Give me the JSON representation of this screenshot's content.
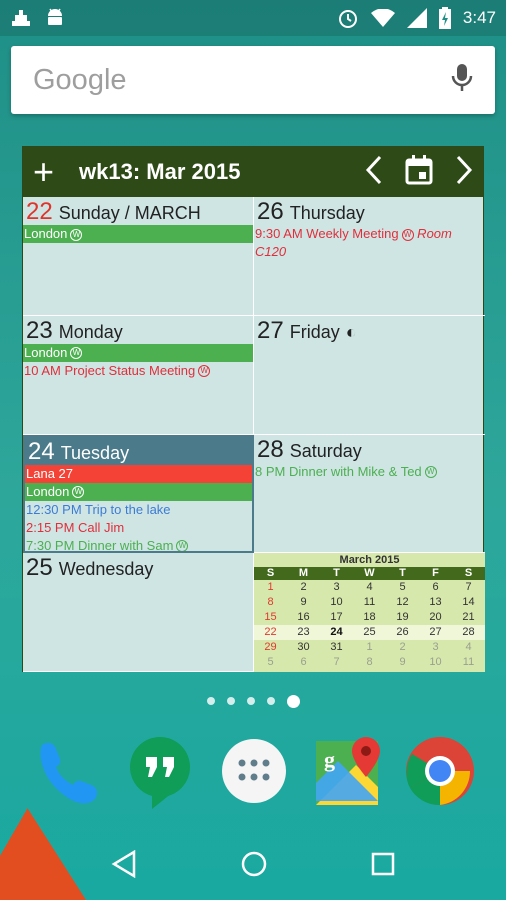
{
  "status_bar": {
    "time": "3:47",
    "left_icons": [
      "android-debug-icon",
      "android-icon"
    ],
    "right_icons": [
      "alarm-icon",
      "wifi-icon",
      "signal-icon",
      "battery-charging-icon"
    ]
  },
  "search": {
    "logo_text": "Google",
    "mic_icon": "mic-icon"
  },
  "widget": {
    "add_label": "+",
    "title": "wk13: Mar 2015",
    "colors": {
      "header": "#2e4a16",
      "cell_bg": "#cfe5e4",
      "event_green": "#4caf50",
      "event_red": "#f44336",
      "today_header": "#4b7a8a"
    },
    "days": [
      {
        "num": "22",
        "name": "Sunday / MARCH",
        "events": [
          {
            "text": "London",
            "style": "bar",
            "w": true
          }
        ]
      },
      {
        "num": "26",
        "name": "Thursday",
        "events": [
          {
            "text": "9:30 AM Weekly Meeting",
            "style": "red",
            "w": true,
            "location": "Room C120"
          }
        ]
      },
      {
        "num": "23",
        "name": "Monday",
        "events": [
          {
            "text": "London",
            "style": "bar",
            "w": true
          },
          {
            "text": "10 AM Project Status Meeting",
            "style": "red",
            "w": true
          }
        ]
      },
      {
        "num": "27",
        "name": "Friday",
        "moon": "◐",
        "events": []
      },
      {
        "num": "24",
        "name": "Tuesday",
        "events": [
          {
            "text": "Lana 27",
            "style": "redbar",
            "w": false
          },
          {
            "text": "London",
            "style": "bar",
            "w": true
          },
          {
            "text": "12:30 PM Trip to the lake",
            "style": "blue",
            "w": false
          },
          {
            "text": "2:15 PM Call Jim",
            "style": "red",
            "w": false
          },
          {
            "text": "7:30 PM Dinner with Sam",
            "style": "green",
            "w": true
          }
        ]
      },
      {
        "num": "28",
        "name": "Saturday",
        "events": [
          {
            "text": "8 PM Dinner with Mike & Ted",
            "style": "green",
            "w": true
          }
        ]
      },
      {
        "num": "25",
        "name": "Wednesday",
        "events": []
      }
    ],
    "mini_month": {
      "title": "March 2015",
      "dow": [
        "S",
        "M",
        "T",
        "W",
        "T",
        "F",
        "S"
      ],
      "weeks": [
        [
          "1",
          "2",
          "3",
          "4",
          "5",
          "6",
          "7"
        ],
        [
          "8",
          "9",
          "10",
          "11",
          "12",
          "13",
          "14"
        ],
        [
          "15",
          "16",
          "17",
          "18",
          "19",
          "20",
          "21"
        ],
        [
          "22",
          "23",
          "24",
          "25",
          "26",
          "27",
          "28"
        ],
        [
          "29",
          "30",
          "31",
          "1",
          "2",
          "3",
          "4"
        ],
        [
          "5",
          "6",
          "7",
          "8",
          "9",
          "10",
          "11"
        ]
      ],
      "today": "24"
    },
    "controls": [
      "chevron-left-icon",
      "calendar-today-icon",
      "chevron-right-icon"
    ],
    "w_mark": "W"
  },
  "page_dots": {
    "count": 5,
    "active": 4
  },
  "dock": [
    "phone-icon",
    "hangouts-icon",
    "app-drawer-icon",
    "maps-icon",
    "chrome-icon"
  ],
  "navbar": [
    "back-icon",
    "home-icon",
    "recents-icon"
  ]
}
